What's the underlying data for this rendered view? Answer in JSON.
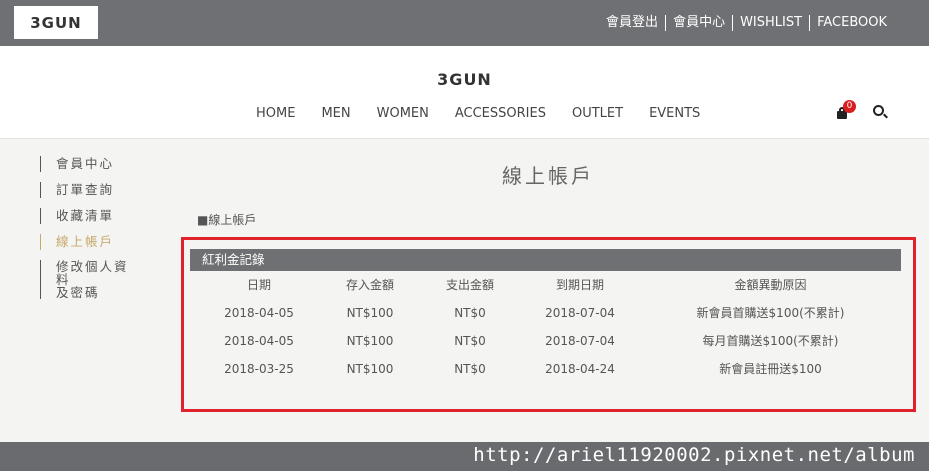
{
  "top": {
    "logo": "3GUN",
    "links": [
      "會員登出",
      "會員中心",
      "WISHLIST",
      "FACEBOOK"
    ]
  },
  "header": {
    "brand": "3GUN",
    "nav": [
      "HOME",
      "MEN",
      "WOMEN",
      "ACCESSORIES",
      "OUTLET",
      "EVENTS"
    ],
    "cart_count": "0"
  },
  "sidebar": {
    "items": [
      "會員中心",
      "訂單查詢",
      "收藏清單",
      "線上帳戶",
      "修改個人資料",
      "及密碼"
    ],
    "active_index": 3
  },
  "main": {
    "title": "線上帳戶",
    "breadcrumb": "■線上帳戶",
    "panel_title": "紅利金記錄",
    "columns": [
      "日期",
      "存入金額",
      "支出金額",
      "到期日期",
      "金額異動原因"
    ],
    "rows": [
      [
        "2018-04-05",
        "NT$100",
        "NT$0",
        "2018-07-04",
        "新會員首購送$100(不累計)"
      ],
      [
        "2018-04-05",
        "NT$100",
        "NT$0",
        "2018-07-04",
        "每月首購送$100(不累計)"
      ],
      [
        "2018-03-25",
        "NT$100",
        "NT$0",
        "2018-04-24",
        "新會員註冊送$100"
      ]
    ]
  },
  "watermark": "http://ariel11920002.pixnet.net/album",
  "colors": {
    "topbar": "#6f7073",
    "highlight": "#e0222d",
    "active": "#c8a96b",
    "badge": "#d81e1e"
  }
}
